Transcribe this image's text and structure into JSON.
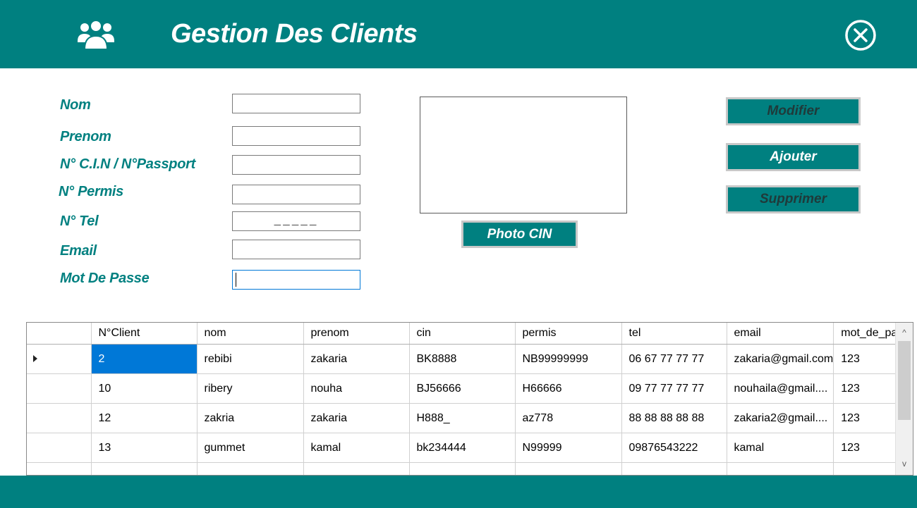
{
  "window": {
    "title": "Gestion Des Clients"
  },
  "colors": {
    "teal": "#008080",
    "selection": "#0078d7"
  },
  "icons": {
    "header": "users-icon",
    "close": "close-icon",
    "row": "row-selector-arrow"
  },
  "form": {
    "nom": {
      "label": "Nom",
      "value": ""
    },
    "prenom": {
      "label": "Prenom",
      "value": ""
    },
    "cin": {
      "label": "N° C.I.N / N°Passport",
      "value": ""
    },
    "permis": {
      "label": "N° Permis",
      "value": ""
    },
    "tel": {
      "label": "N° Tel",
      "mask": "_____"
    },
    "email": {
      "label": "Email",
      "value": ""
    },
    "password": {
      "label": "Mot De Passe",
      "value": ""
    }
  },
  "buttons": {
    "photo": "Photo CIN",
    "modifier": "Modifier",
    "ajouter": "Ajouter",
    "supprimer": "Supprimer"
  },
  "table": {
    "columns": [
      "N°Client",
      "nom",
      "prenom",
      "cin",
      "permis",
      "tel",
      "email",
      "mot_de_pa"
    ],
    "rows": [
      [
        "2",
        "rebibi",
        "zakaria",
        "BK8888",
        "NB99999999",
        "06 67 77 77 77",
        "zakaria@gmail.com",
        "123"
      ],
      [
        "10",
        "ribery",
        "nouha",
        "BJ56666",
        "H66666",
        "09 77 77 77 77",
        "nouhaila@gmail....",
        "123"
      ],
      [
        "12",
        "zakria",
        "zakaria",
        "H888_",
        "az778",
        "88 88 88 88 88",
        "zakaria2@gmail....",
        "123"
      ],
      [
        "13",
        "gummet",
        "kamal",
        "bk234444",
        "N99999",
        "09876543222",
        "kamal",
        "123"
      ]
    ],
    "selected_row": 0
  },
  "scrollbar": {
    "up": "^",
    "down": "v"
  }
}
